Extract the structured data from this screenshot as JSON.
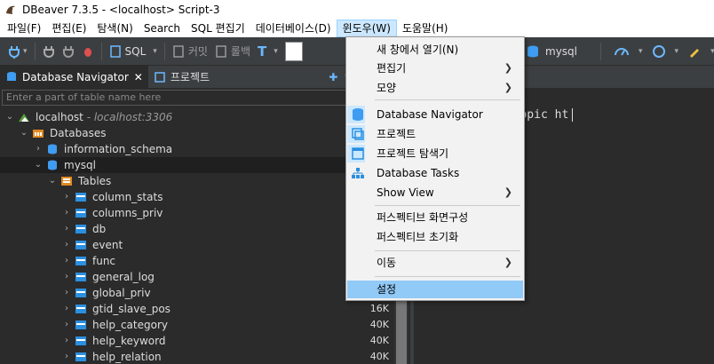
{
  "window": {
    "title": "DBeaver 7.3.5 - <localhost> Script-3"
  },
  "menubar": {
    "items": [
      "파일(F)",
      "편집(E)",
      "탐색(N)",
      "Search",
      "SQL 편집기",
      "데이터베이스(D)",
      "윈도우(W)",
      "도움말(H)"
    ],
    "active_index": 6
  },
  "toolbar": {
    "sql_label": "SQL",
    "commit_label": "커밋",
    "rollback_label": "롤백",
    "db_label": "mysql"
  },
  "navigator": {
    "tab_active": "Database Navigator",
    "tab_other": "프로젝트",
    "filter_placeholder": "Enter a part of table name here",
    "tree": [
      {
        "label": "localhost",
        "dim": " - localhost:3306",
        "depth": 0,
        "expanded": true,
        "icon": "connection-icon"
      },
      {
        "label": "Databases",
        "depth": 1,
        "expanded": true,
        "icon": "folder-icon"
      },
      {
        "label": "information_schema",
        "depth": 2,
        "expanded": false,
        "icon": "database-icon"
      },
      {
        "label": "mysql",
        "depth": 2,
        "expanded": true,
        "icon": "database-icon",
        "selected": true
      },
      {
        "label": "Tables",
        "depth": 3,
        "expanded": true,
        "icon": "tables-folder-icon"
      },
      {
        "label": "column_stats",
        "depth": 4,
        "expanded": false,
        "icon": "table-icon"
      },
      {
        "label": "columns_priv",
        "depth": 4,
        "expanded": false,
        "icon": "table-icon"
      },
      {
        "label": "db",
        "depth": 4,
        "expanded": false,
        "icon": "table-icon"
      },
      {
        "label": "event",
        "depth": 4,
        "expanded": false,
        "icon": "table-icon"
      },
      {
        "label": "func",
        "depth": 4,
        "expanded": false,
        "icon": "table-icon"
      },
      {
        "label": "general_log",
        "depth": 4,
        "expanded": false,
        "icon": "table-icon"
      },
      {
        "label": "global_priv",
        "depth": 4,
        "expanded": false,
        "icon": "table-icon"
      },
      {
        "label": "gtid_slave_pos",
        "depth": 4,
        "expanded": false,
        "icon": "table-icon",
        "size": "16K"
      },
      {
        "label": "help_category",
        "depth": 4,
        "expanded": false,
        "icon": "table-icon",
        "size": "40K"
      },
      {
        "label": "help_keyword",
        "depth": 4,
        "expanded": false,
        "icon": "table-icon",
        "size": "40K"
      },
      {
        "label": "help_relation",
        "depth": 4,
        "expanded": false,
        "icon": "table-icon",
        "size": "40K"
      }
    ]
  },
  "editor": {
    "tab_label": "t-3",
    "code_text": "p_topic ht"
  },
  "window_menu": {
    "items": [
      {
        "label": "새 창에서 열기(N)",
        "submenu": false
      },
      {
        "label": "편집기",
        "submenu": true
      },
      {
        "label": "모양",
        "submenu": true
      },
      {
        "separator": true
      },
      {
        "label": "Database Navigator",
        "submenu": false,
        "icon": "database-navigator-icon"
      },
      {
        "label": "프로젝트",
        "submenu": false,
        "icon": "projects-icon"
      },
      {
        "label": "프로젝트 탐색기",
        "submenu": false,
        "icon": "project-explorer-icon"
      },
      {
        "label": "Database Tasks",
        "submenu": false,
        "icon": "database-tasks-icon"
      },
      {
        "label": "Show View",
        "submenu": true
      },
      {
        "separator": true
      },
      {
        "label": "퍼스펙티브 화면구성",
        "submenu": false
      },
      {
        "label": "퍼스펙티브 초기화",
        "submenu": false
      },
      {
        "separator": true
      },
      {
        "label": "이동",
        "submenu": true
      },
      {
        "separator": true
      },
      {
        "label": "설정",
        "submenu": false,
        "highlight": true
      }
    ]
  },
  "colors": {
    "accent": "#91c9f7",
    "panel": "#2b2b2b",
    "toolbar": "#3c3f41"
  }
}
